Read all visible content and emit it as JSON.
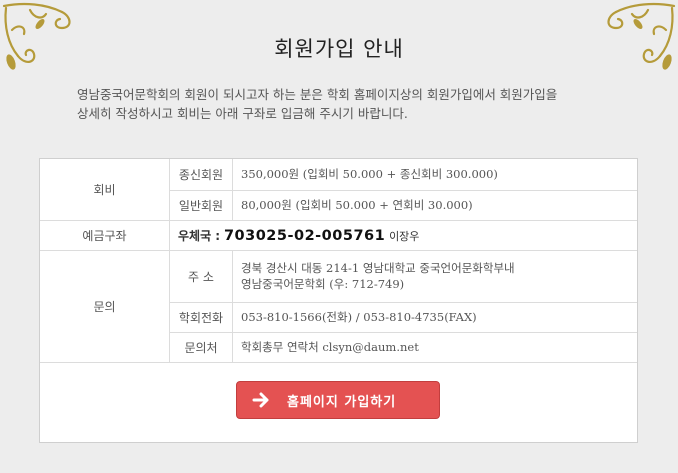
{
  "page": {
    "title": "회원가입 안내",
    "intro_line1": "영남중국어문학회의 회원이 되시고자 하는 분은 학회 홈페이지상의 회원가입에서 회원가입을",
    "intro_line2": "상세히 작성하시고 회비는 아래 구좌로 입금해 주시기 바랍니다."
  },
  "fees": {
    "header": "회비",
    "rows": [
      {
        "label": "종신회원",
        "value": "350,000원 (입회비 50.000 + 종신회비 300.000)"
      },
      {
        "label": "일반회원",
        "value": "80,000원 (입회비 50.000 + 연회비 30.000)"
      }
    ]
  },
  "account": {
    "header": "예금구좌",
    "bank": "우체국 :",
    "number": "703025-02-005761",
    "holder": "이장우"
  },
  "contact": {
    "header": "문의",
    "address_label": "주 소",
    "address_line1": "경북 경산시 대동 214-1 영남대학교 중국언어문화학부내",
    "address_line2": "영남중국어문학회 (우: 712-749)",
    "phone_label": "학회전화",
    "phone_value": "053-810-1566(전화) / 053-810-4735(FAX)",
    "email_label": "문의처",
    "email_value": "학회총무 연락처 clsyn@daum.net"
  },
  "button": {
    "label": "홈페이지 가입하기"
  },
  "colors": {
    "button": "#e45252",
    "ornament": "#b59b3a"
  },
  "icons": {
    "button_arrow": "arrow-right-icon",
    "ornaments": "floral-ornament-icon"
  }
}
